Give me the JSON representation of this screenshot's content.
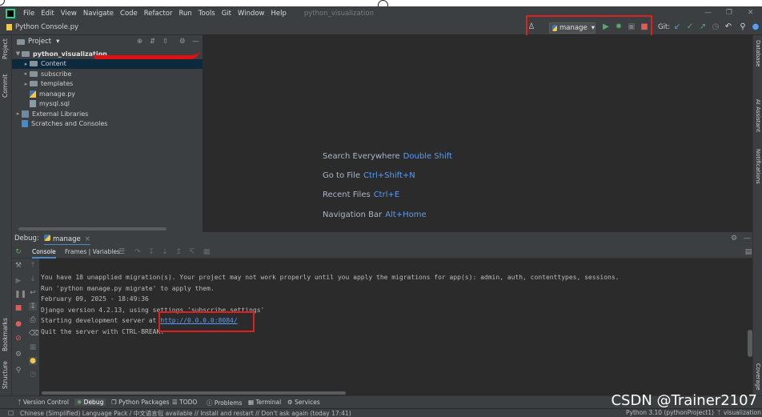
{
  "menu": [
    "File",
    "Edit",
    "View",
    "Navigate",
    "Code",
    "Refactor",
    "Run",
    "Tools",
    "Git",
    "Window",
    "Help"
  ],
  "window_title": "python_visualization",
  "window_controls": [
    "—",
    "❐",
    "✕"
  ],
  "breadcrumb": "Python Console.py",
  "run_config": {
    "label": "manage",
    "dropdown": "▾"
  },
  "git_label": "Git:",
  "project_panel": {
    "title": "Project",
    "tree": [
      {
        "label": "python_visualization",
        "kind": "folder",
        "expanded": true
      },
      {
        "label": "Content",
        "kind": "folder",
        "selected": true
      },
      {
        "label": "subscribe",
        "kind": "folder"
      },
      {
        "label": "templates",
        "kind": "folder"
      },
      {
        "label": "manage.py",
        "kind": "py"
      },
      {
        "label": "mysql.sql",
        "kind": "sql"
      },
      {
        "label": "External Libraries",
        "kind": "lib"
      },
      {
        "label": "Scratches and Consoles",
        "kind": "scratch"
      }
    ]
  },
  "left_strip": [
    "Project",
    "Commit",
    "Bookmarks",
    "Structure"
  ],
  "right_strip": [
    "Database",
    "AI Assistant",
    "Notifications",
    "Coverage"
  ],
  "editor_hints": [
    {
      "label": "Search Everywhere",
      "key": "Double Shift"
    },
    {
      "label": "Go to File",
      "key": "Ctrl+Shift+N"
    },
    {
      "label": "Recent Files",
      "key": "Ctrl+E"
    },
    {
      "label": "Navigation Bar",
      "key": "Alt+Home"
    }
  ],
  "debug": {
    "title": "Debug:",
    "session_tab": "manage",
    "tabs": [
      "Console",
      "Frames | Variables"
    ],
    "console": {
      "line1": "You have 18 unapplied migration(s). Your project may not work properly until you apply the migrations for app(s): admin, auth, contenttypes, sessions.",
      "line2": "Run 'python manage.py migrate' to apply them.",
      "line3": "February 09, 2025 - 18:49:36",
      "line4": "Django version 4.2.13, using settings 'subscribe.settings'",
      "line5_prefix": "Starting development server at ",
      "line5_link": "http://0.0.0.0:8084/",
      "line6": "Quit the server with CTRL-BREAK."
    }
  },
  "bottom_tools": [
    "Version Control",
    "Debug",
    "Python Packages",
    "TODO",
    "Problems",
    "Terminal",
    "Services"
  ],
  "status": {
    "message": "Chinese (Simplified) Language Pack / 中文语言包 available // Install and restart // Don't ask again (today 17:41)",
    "interpreter": "Python 3.10 (pythonProject1)",
    "branch": "visualization"
  },
  "watermark": "CSDN @Trainer2107",
  "colors": {
    "accent": "#589df6",
    "annotation": "#e02020",
    "run_green": "#59a869",
    "stop_red": "#db5c5c"
  }
}
